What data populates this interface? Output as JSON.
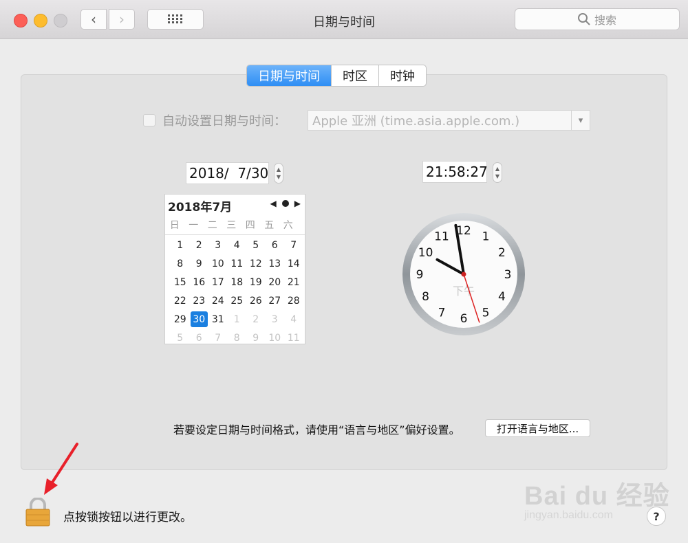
{
  "window": {
    "title": "日期与时间",
    "search_placeholder": "搜索",
    "nav_back": "‹",
    "nav_forward": "›"
  },
  "tabs": [
    {
      "label": "日期与时间",
      "active": true
    },
    {
      "label": "时区",
      "active": false
    },
    {
      "label": "时钟",
      "active": false
    }
  ],
  "auto_time": {
    "label": "自动设置日期与时间：",
    "checked": false,
    "server": "Apple 亚洲 (time.asia.apple.com.)"
  },
  "date_field": "2018/  7/30",
  "time_field": "21:58:27",
  "calendar": {
    "month_title": "2018年7月",
    "weekdays": [
      "日",
      "一",
      "二",
      "三",
      "四",
      "五",
      "六"
    ],
    "rows": [
      [
        "1",
        "2",
        "3",
        "4",
        "5",
        "6",
        "7"
      ],
      [
        "8",
        "9",
        "10",
        "11",
        "12",
        "13",
        "14"
      ],
      [
        "15",
        "16",
        "17",
        "18",
        "19",
        "20",
        "21"
      ],
      [
        "22",
        "23",
        "24",
        "25",
        "26",
        "27",
        "28"
      ],
      [
        "29",
        "30",
        "31",
        "1",
        "2",
        "3",
        "4"
      ],
      [
        "5",
        "6",
        "7",
        "8",
        "9",
        "10",
        "11"
      ]
    ],
    "selected": "30"
  },
  "clock": {
    "numbers": [
      "12",
      "1",
      "2",
      "3",
      "4",
      "5",
      "6",
      "7",
      "8",
      "9",
      "10",
      "11"
    ],
    "ampm": "下午",
    "hour": 21,
    "minute": 58,
    "second": 27
  },
  "format_hint": "若要设定日期与时间格式，请使用“语言与地区”偏好设置。",
  "open_region_button": "打开语言与地区...",
  "lock_text": "点按锁按钮以进行更改。",
  "help_label": "?",
  "watermark": {
    "brand": "Bai du 经验",
    "url": "jingyan.baidu.com"
  },
  "colors": {
    "accent": "#2f8ef4",
    "annotation_arrow": "#e8202a",
    "lock": "#e8a63a"
  }
}
